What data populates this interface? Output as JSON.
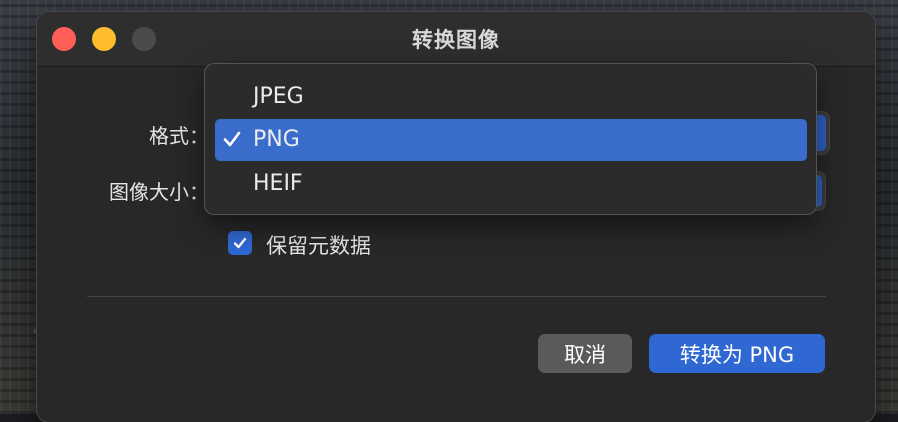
{
  "window": {
    "title": "转换图像"
  },
  "form": {
    "format_label": "格式：",
    "size_label": "图像大小：",
    "metadata_checkbox": {
      "label": "保留元数据",
      "checked": true
    }
  },
  "format_menu": {
    "items": [
      {
        "label": "JPEG",
        "selected": false
      },
      {
        "label": "PNG",
        "selected": true
      },
      {
        "label": "HEIF",
        "selected": false
      }
    ]
  },
  "buttons": {
    "cancel": "取消",
    "convert": "转换为 PNG"
  },
  "colors": {
    "accent": "#2f68d3",
    "close": "#fe5f57",
    "minimize": "#febc2e",
    "zoom_disabled": "#4b4b4b"
  }
}
